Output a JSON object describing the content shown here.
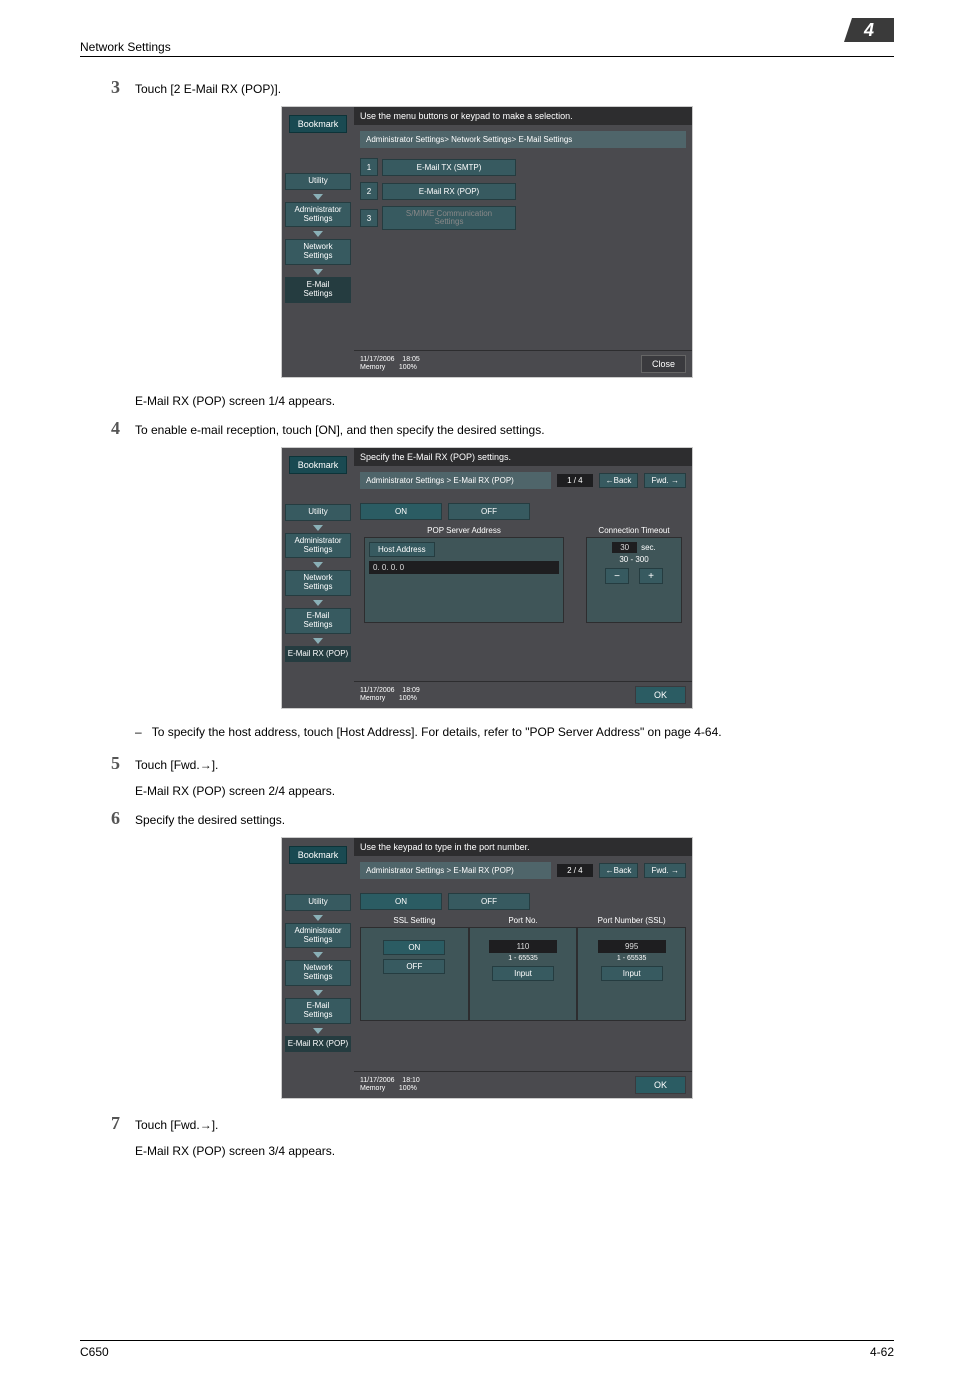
{
  "header": {
    "section_title": "Network Settings",
    "chapter_num": "4"
  },
  "steps": {
    "s3": {
      "num": "3",
      "text": "Touch [2 E-Mail RX (POP)]."
    },
    "s3_after": "E-Mail RX (POP) screen 1/4 appears.",
    "s4": {
      "num": "4",
      "text": "To enable e-mail reception, touch [ON], and then specify the desired settings."
    },
    "s4_sub": "To specify the host address, touch [Host Address]. For details, refer to \"POP Server Address\" on page 4-64.",
    "s5": {
      "num": "5",
      "text_pre": "Touch [Fwd.",
      "text_post": "]."
    },
    "s5_after": "E-Mail RX (POP) screen 2/4 appears.",
    "s6": {
      "num": "6",
      "text": "Specify the desired settings."
    },
    "s7": {
      "num": "7",
      "text_pre": "Touch [Fwd.",
      "text_post": "]."
    },
    "s7_after": "E-Mail RX (POP) screen 3/4 appears."
  },
  "screen1": {
    "instruction": "Use the menu buttons or keypad to make a selection.",
    "bookmark": "Bookmark",
    "sidebar": [
      "Utility",
      "Administrator\nSettings",
      "Network\nSettings",
      "E-Mail\nSettings"
    ],
    "breadcrumb": "Administrator Settings> Network Settings> E-Mail Settings",
    "menu": [
      {
        "num": "1",
        "label": "E-Mail TX (SMTP)"
      },
      {
        "num": "2",
        "label": "E-Mail RX (POP)"
      },
      {
        "num": "3",
        "label": "S/MIME Communication\nSettings",
        "grayed": true
      }
    ],
    "footer_date": "11/17/2006",
    "footer_time": "18:05",
    "footer_mem": "Memory",
    "footer_pct": "100%",
    "close": "Close"
  },
  "screen2": {
    "instruction": "Specify the E-Mail RX (POP) settings.",
    "bookmark": "Bookmark",
    "sidebar": [
      "Utility",
      "Administrator\nSettings",
      "Network\nSettings",
      "E-Mail\nSettings",
      "E-Mail RX (POP)"
    ],
    "breadcrumb": "Administrator Settings > E-Mail RX (POP)",
    "page": "1 / 4",
    "back": "←Back",
    "fwd": "Fwd. →",
    "on": "ON",
    "off": "OFF",
    "pop_hdr": "POP Server Address",
    "timeout_hdr": "Connection Timeout",
    "host_btn": "Host Address",
    "host_val": "0. 0. 0. 0",
    "timeout_val": "30",
    "timeout_unit": "sec.",
    "timeout_min": "30",
    "timeout_max": "300",
    "footer_date": "11/17/2006",
    "footer_time": "18:09",
    "footer_mem": "Memory",
    "footer_pct": "100%",
    "ok": "OK"
  },
  "screen3": {
    "instruction": "Use the keypad to type in the port number.",
    "bookmark": "Bookmark",
    "sidebar": [
      "Utility",
      "Administrator\nSettings",
      "Network\nSettings",
      "E-Mail\nSettings",
      "E-Mail RX (POP)"
    ],
    "breadcrumb": "Administrator Settings > E-Mail RX (POP)",
    "page": "2 / 4",
    "back": "←Back",
    "fwd": "Fwd. →",
    "on": "ON",
    "off": "OFF",
    "col1_hdr": "SSL Setting",
    "col2_hdr": "Port No.",
    "col3_hdr": "Port Number (SSL)",
    "ssl_on": "ON",
    "ssl_off": "OFF",
    "port_val": "110",
    "port_range": "1   -   65535",
    "port_input": "Input",
    "ssl_port_val": "995",
    "ssl_port_range": "1   -   65535",
    "ssl_port_input": "Input",
    "footer_date": "11/17/2006",
    "footer_time": "18:10",
    "footer_mem": "Memory",
    "footer_pct": "100%",
    "ok": "OK"
  },
  "chart_data": {
    "type": "table",
    "screens": [
      {
        "name": "E-Mail Settings menu",
        "items": [
          "E-Mail TX (SMTP)",
          "E-Mail RX (POP)",
          "S/MIME Communication Settings"
        ]
      },
      {
        "name": "E-Mail RX (POP) 1/4",
        "fields": {
          "ON_OFF": "ON",
          "POP Server Address": "0.0.0.0",
          "Connection Timeout": {
            "value": 30,
            "unit": "sec",
            "range": [
              30,
              300
            ]
          }
        }
      },
      {
        "name": "E-Mail RX (POP) 2/4",
        "fields": {
          "ON_OFF": "ON",
          "SSL Setting": [
            "ON",
            "OFF"
          ],
          "Port No.": {
            "value": 110,
            "range": [
              1,
              65535
            ]
          },
          "Port Number (SSL)": {
            "value": 995,
            "range": [
              1,
              65535
            ]
          }
        }
      }
    ]
  },
  "page_footer": {
    "left": "C650",
    "right": "4-62"
  }
}
